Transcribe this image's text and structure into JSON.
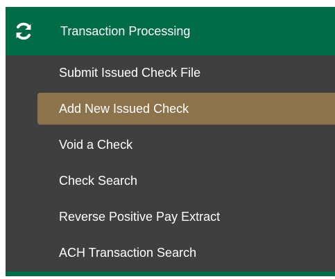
{
  "header": {
    "title": "Transaction Processing",
    "icon": "refresh-icon"
  },
  "menu": {
    "items": [
      {
        "label": "Submit Issued Check File",
        "active": false
      },
      {
        "label": "Add New Issued Check",
        "active": true
      },
      {
        "label": "Void a Check",
        "active": false
      },
      {
        "label": "Check Search",
        "active": false
      },
      {
        "label": "Reverse Positive Pay Extract",
        "active": false
      },
      {
        "label": "ACH Transaction Search",
        "active": false
      }
    ]
  },
  "colors": {
    "header_bg": "#006b47",
    "panel_bg": "#3f3f3f",
    "active_bg": "#8c734b",
    "text": "#ffffff"
  }
}
